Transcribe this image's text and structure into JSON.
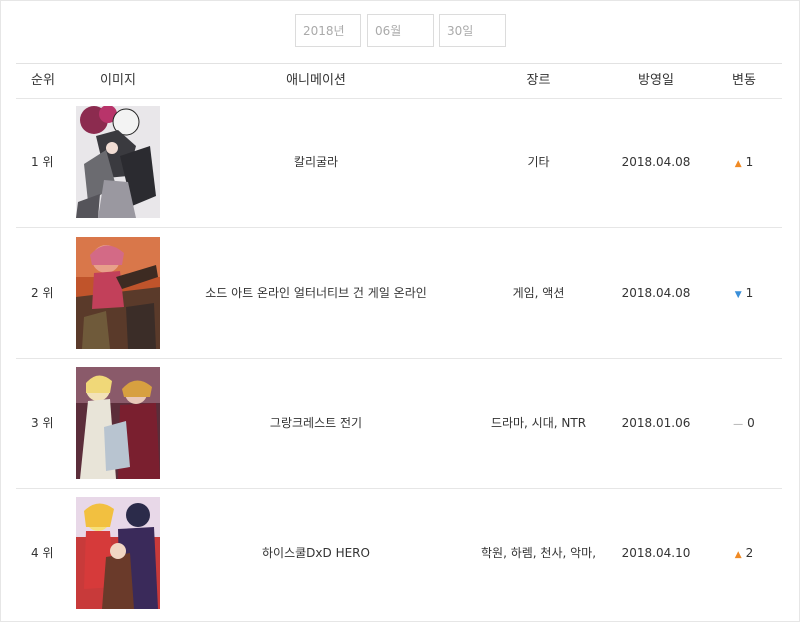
{
  "date_selector": {
    "year": "2018년",
    "month": "06월",
    "day": "30일"
  },
  "columns": {
    "rank": "순위",
    "image": "이미지",
    "title": "애니메이션",
    "genre": "장르",
    "air_date": "방영일",
    "change": "변동"
  },
  "rows": [
    {
      "rank": "1 위",
      "image": "poster-kaligula",
      "title": "칼리굴라",
      "genre": "기타",
      "air_date": "2018.04.08",
      "change": {
        "icon": "arrow-up-icon",
        "value": "1"
      }
    },
    {
      "rank": "2 위",
      "image": "poster-sao-ggo",
      "title": "소드 아트 온라인 얼터너티브 건 게일 온라인",
      "genre": "게임, 액션",
      "air_date": "2018.04.08",
      "change": {
        "icon": "arrow-down-icon",
        "value": "1"
      }
    },
    {
      "rank": "3 위",
      "image": "poster-grancrest",
      "title": "그랑크레스트 전기",
      "genre": "드라마, 시대, NTR",
      "air_date": "2018.01.06",
      "change": {
        "icon": "dash-icon",
        "value": "0"
      }
    },
    {
      "rank": "4 위",
      "image": "poster-highschool-dxd-hero",
      "title": "하이스쿨DxD HERO",
      "genre": "학원, 하렘, 천사, 악마,",
      "air_date": "2018.04.10",
      "change": {
        "icon": "arrow-up-icon",
        "value": "2"
      }
    }
  ],
  "colors": {
    "up": "#f08a24",
    "down": "#3a8fd9",
    "border": "#e6e6e6"
  }
}
